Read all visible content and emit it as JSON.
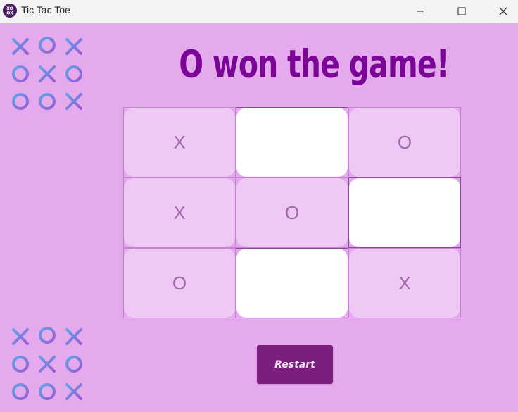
{
  "window": {
    "title": "Tic Tac Toe",
    "icon": "tic-tac-toe-app-icon"
  },
  "status": {
    "message": "O won the game!"
  },
  "board": {
    "cells": [
      "X",
      "",
      "O",
      "X",
      "O",
      "",
      "O",
      "",
      "X"
    ]
  },
  "restart_label": "Restart",
  "colors": {
    "background": "#e4aaed",
    "headline": "#7a0597",
    "filled_cell": "#edc9f3",
    "empty_cell": "#ffffff",
    "mark": "#a068ab",
    "restart_button": "#7b1e7e"
  }
}
